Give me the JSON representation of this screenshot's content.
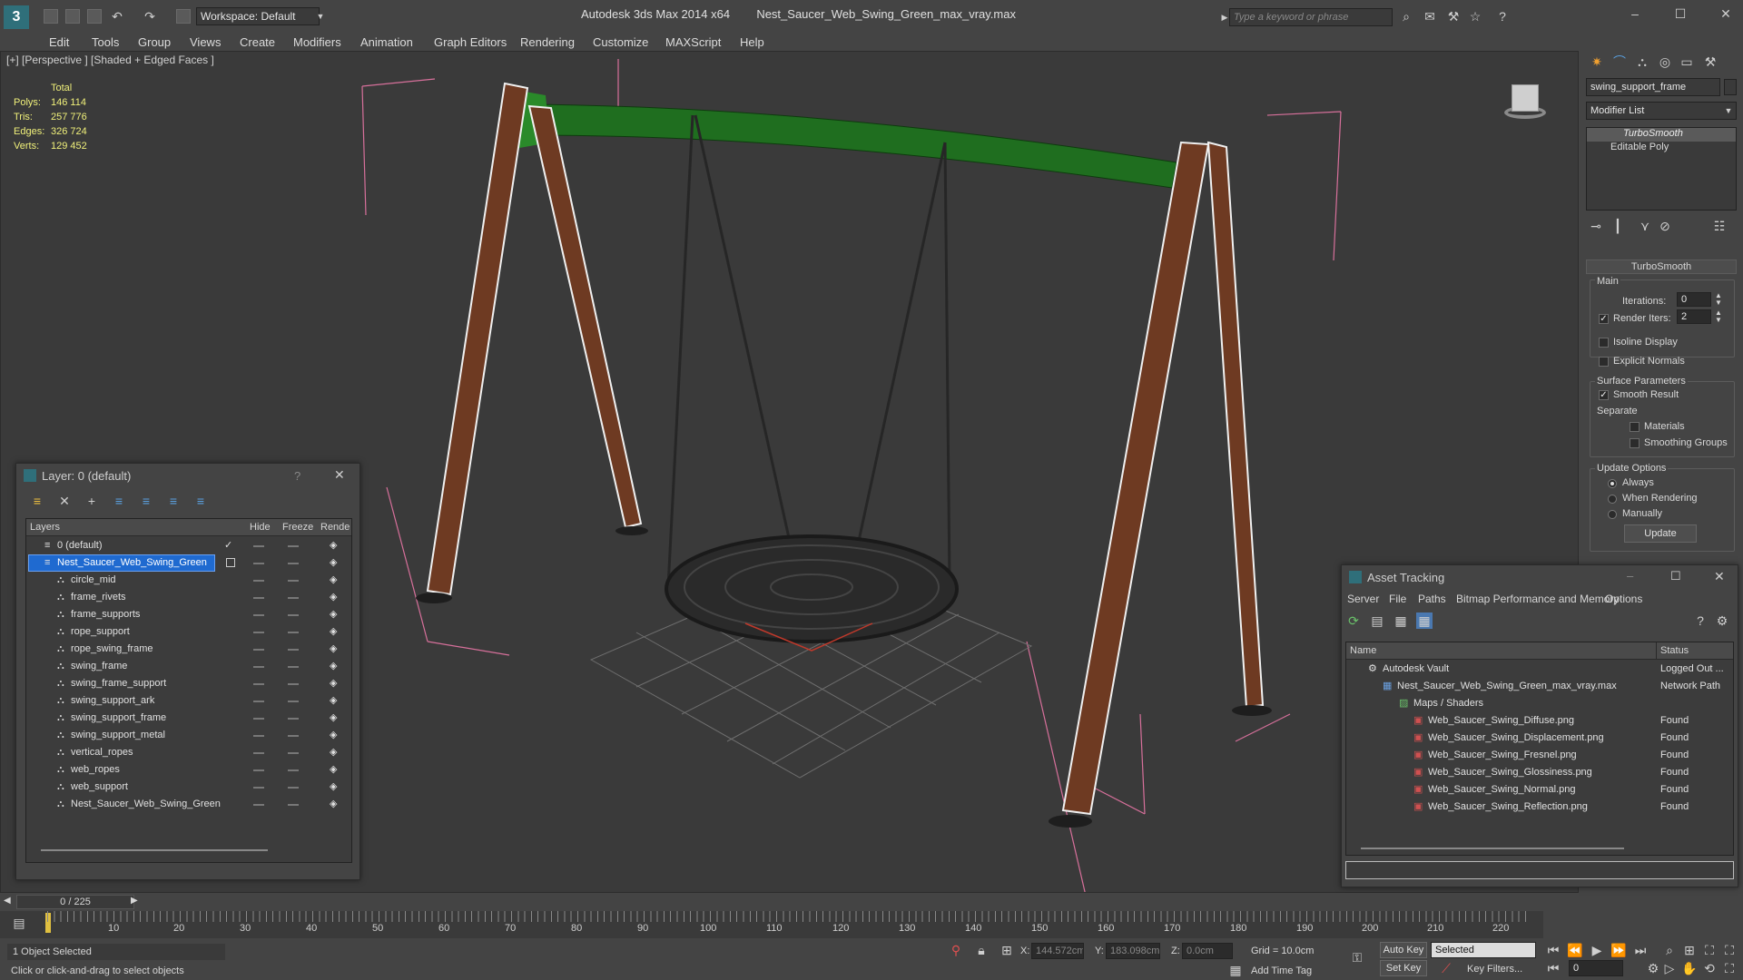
{
  "app": {
    "title": "Autodesk 3ds Max  2014 x64",
    "file": "Nest_Saucer_Web_Swing_Green_max_vray.max",
    "workspace": "Workspace: Default",
    "search_placeholder": "Type a keyword or phrase"
  },
  "menu": [
    "Edit",
    "Tools",
    "Group",
    "Views",
    "Create",
    "Modifiers",
    "Animation",
    "Graph Editors",
    "Rendering",
    "Customize",
    "MAXScript",
    "Help"
  ],
  "viewport": {
    "label": "[+] [Perspective ] [Shaded + Edged Faces ]",
    "stats_header": "Total",
    "stats": [
      {
        "label": "Polys:",
        "value": "146 114"
      },
      {
        "label": "Tris:",
        "value": "257 776"
      },
      {
        "label": "Edges:",
        "value": "326 724"
      },
      {
        "label": "Verts:",
        "value": "129 452"
      }
    ]
  },
  "command_panel": {
    "object_name": "swing_support_frame",
    "modifier_list": "Modifier List",
    "stack": [
      "TurboSmooth",
      "Editable Poly"
    ],
    "rollout_title": "TurboSmooth",
    "main_label": "Main",
    "iterations_label": "Iterations:",
    "iterations_value": "0",
    "render_iters_label": "Render Iters:",
    "render_iters_value": "2",
    "isoline": "Isoline Display",
    "explicit_normals": "Explicit Normals",
    "surface_params": "Surface Parameters",
    "smooth_result": "Smooth Result",
    "separate": "Separate",
    "materials": "Materials",
    "smoothing_groups": "Smoothing Groups",
    "update_options": "Update Options",
    "always": "Always",
    "when_rendering": "When Rendering",
    "manually": "Manually",
    "update_button": "Update"
  },
  "layer_window": {
    "title": "Layer: 0 (default)",
    "help": "?",
    "columns": [
      "Layers",
      "Hide",
      "Freeze",
      "Rende"
    ],
    "default_layer": "0 (default)",
    "selected_layer": "Nest_Saucer_Web_Swing_Green",
    "objects": [
      "circle_mid",
      "frame_rivets",
      "frame_supports",
      "rope_support",
      "rope_swing_frame",
      "swing_frame",
      "swing_frame_support",
      "swing_support_ark",
      "swing_support_frame",
      "swing_support_metal",
      "vertical_ropes",
      "web_ropes",
      "web_support",
      "Nest_Saucer_Web_Swing_Green"
    ]
  },
  "asset_window": {
    "title": "Asset Tracking",
    "menu": [
      "Server",
      "File",
      "Paths",
      "Bitmap Performance and Memory",
      "Options"
    ],
    "columns": [
      "Name",
      "Status"
    ],
    "rows": [
      {
        "name": "Autodesk Vault",
        "status": "Logged Out ...",
        "indent": 1
      },
      {
        "name": "Nest_Saucer_Web_Swing_Green_max_vray.max",
        "status": "Network Path",
        "indent": 2
      },
      {
        "name": "Maps / Shaders",
        "status": "",
        "indent": 3
      },
      {
        "name": "Web_Saucer_Swing_Diffuse.png",
        "status": "Found",
        "indent": 4
      },
      {
        "name": "Web_Saucer_Swing_Displacement.png",
        "status": "Found",
        "indent": 4
      },
      {
        "name": "Web_Saucer_Swing_Fresnel.png",
        "status": "Found",
        "indent": 4
      },
      {
        "name": "Web_Saucer_Swing_Glossiness.png",
        "status": "Found",
        "indent": 4
      },
      {
        "name": "Web_Saucer_Swing_Normal.png",
        "status": "Found",
        "indent": 4
      },
      {
        "name": "Web_Saucer_Swing_Reflection.png",
        "status": "Found",
        "indent": 4
      }
    ]
  },
  "timeline": {
    "frame": "0 / 225",
    "ticks": [
      "10",
      "20",
      "30",
      "40",
      "50",
      "60",
      "70",
      "80",
      "90",
      "100",
      "110",
      "120",
      "130",
      "140",
      "150",
      "160",
      "170",
      "180",
      "190",
      "200",
      "210",
      "220"
    ]
  },
  "status": {
    "selected": "1 Object Selected",
    "prompt": "Click or click-and-drag to select objects",
    "x_label": "X:",
    "x_value": "144.572cm",
    "y_label": "Y:",
    "y_value": "183.098cm",
    "z_label": "Z:",
    "z_value": "0.0cm",
    "grid": "Grid = 10.0cm",
    "add_time_tag": "Add Time Tag",
    "auto_key": "Auto Key",
    "set_key": "Set Key",
    "selected_dropdown": "Selected",
    "key_filters": "Key Filters...",
    "frame_value": "0"
  }
}
